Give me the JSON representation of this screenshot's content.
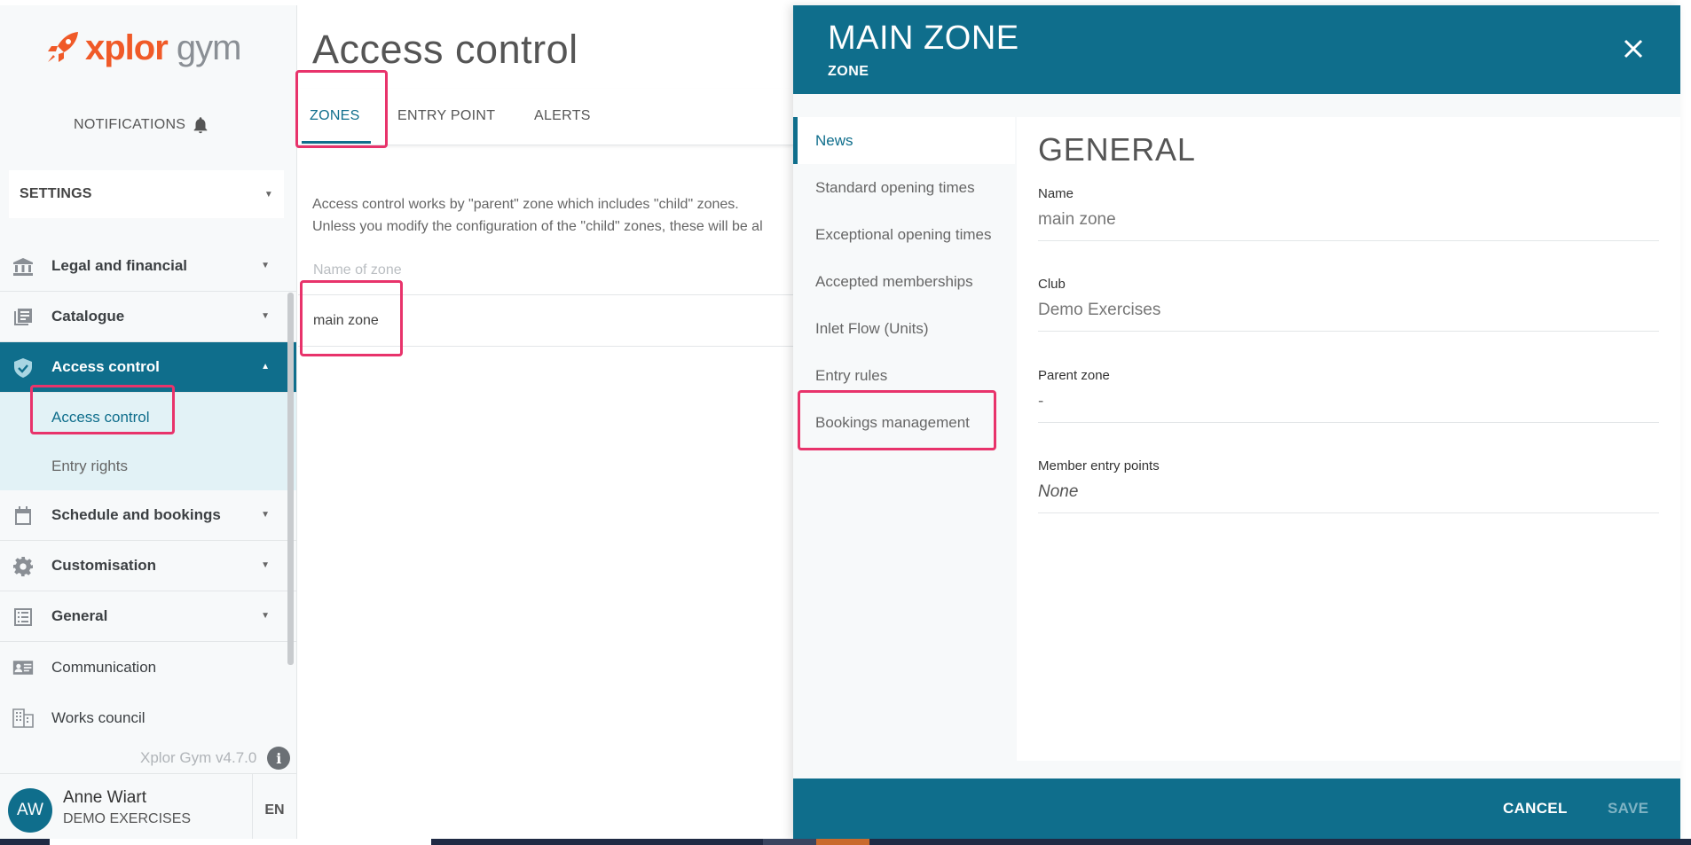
{
  "brand": {
    "logo_xplor": "xplor",
    "logo_gym": "gym",
    "accent": "#0f6e8c",
    "logo_color": "#f05a28",
    "highlight": "#e8336b"
  },
  "sidebar": {
    "notifications_label": "NOTIFICATIONS",
    "settings_select": "SETTINGS",
    "items": [
      {
        "label": "Legal and financial",
        "icon": "bank-icon"
      },
      {
        "label": "Catalogue",
        "icon": "catalogue-icon"
      },
      {
        "label": "Access control",
        "icon": "shield-check-icon"
      },
      {
        "label": "Schedule and bookings",
        "icon": "calendar-icon"
      },
      {
        "label": "Customisation",
        "icon": "gear-icon"
      },
      {
        "label": "General",
        "icon": "list-icon"
      },
      {
        "label": "Communication",
        "icon": "id-card-icon"
      },
      {
        "label": "Works council",
        "icon": "building-icon"
      }
    ],
    "submenu": [
      {
        "label": "Access control"
      },
      {
        "label": "Entry rights"
      }
    ],
    "version": "Xplor Gym v4.7.0",
    "user": {
      "initials": "AW",
      "name": "Anne Wiart",
      "org": "DEMO EXERCISES",
      "lang": "EN"
    }
  },
  "main": {
    "title": "Access control",
    "tabs": [
      {
        "label": "ZONES"
      },
      {
        "label": "ENTRY POINT"
      },
      {
        "label": "ALERTS"
      }
    ],
    "desc_line1": "Access control works by \"parent\" zone which includes \"child\" zones.",
    "desc_line2": "Unless you modify the configuration of the \"child\" zones, these will be al",
    "column_header": "Name of zone",
    "rows": [
      {
        "name": "main zone"
      }
    ]
  },
  "drawer": {
    "title": "MAIN ZONE",
    "subtitle": "ZONE",
    "nav": [
      {
        "label": "News"
      },
      {
        "label": "Standard opening times"
      },
      {
        "label": "Exceptional opening times"
      },
      {
        "label": "Accepted memberships"
      },
      {
        "label": "Inlet Flow (Units)"
      },
      {
        "label": "Entry rules"
      },
      {
        "label": "Bookings management"
      }
    ],
    "section_title": "GENERAL",
    "fields": [
      {
        "label": "Name",
        "value": "main zone"
      },
      {
        "label": "Club",
        "value": "Demo Exercises"
      },
      {
        "label": "Parent zone",
        "value": "-"
      },
      {
        "label": "Member entry points",
        "value": "None"
      }
    ],
    "cancel_label": "CANCEL",
    "save_label": "SAVE"
  }
}
